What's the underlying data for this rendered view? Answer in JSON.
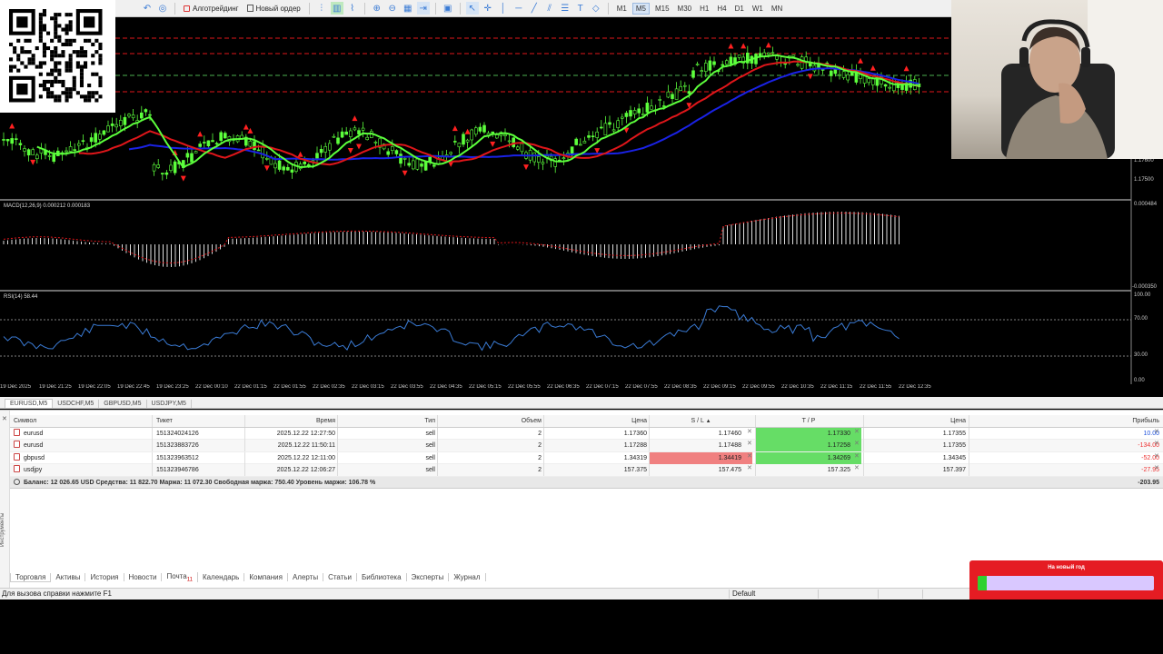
{
  "toolbar": {
    "algo_label": "Алготрейдинг",
    "new_order_label": "Новый ордер",
    "timeframes": [
      "M1",
      "M5",
      "M15",
      "M30",
      "H1",
      "H4",
      "D1",
      "W1",
      "MN"
    ],
    "active_timeframe": "M5"
  },
  "chart": {
    "price_labels": [
      "1.17600",
      "1.17500"
    ],
    "macd_label": "MACD(12,26,9) 0.000212 0.000183",
    "macd_top": "0.000484",
    "macd_bottom": "-0.000350",
    "rsi_label": "RSI(14) 58.44",
    "rsi_levels": [
      "100.00",
      "70.00",
      "30.00",
      "0.00"
    ],
    "time_labels": [
      "19 Dec 2025",
      "19 Dec 21:25",
      "19 Dec 22:05",
      "19 Dec 22:45",
      "19 Dec 23:25",
      "22 Dec 00:10",
      "22 Dec 01:15",
      "22 Dec 01:55",
      "22 Dec 02:35",
      "22 Dec 03:15",
      "22 Dec 03:55",
      "22 Dec 04:35",
      "22 Dec 05:15",
      "22 Dec 05:55",
      "22 Dec 06:35",
      "22 Dec 07:15",
      "22 Dec 07:55",
      "22 Dec 08:35",
      "22 Dec 09:15",
      "22 Dec 09:55",
      "22 Dec 10:35",
      "22 Dec 11:15",
      "22 Dec 11:55",
      "22 Dec 12:35"
    ]
  },
  "chart_tabs": [
    "EURUSD,M5",
    "USDCHF,M5",
    "GBPUSD,M5",
    "USDJPY,M5"
  ],
  "table": {
    "headers": {
      "symbol": "Символ",
      "ticket": "Тикет",
      "time": "Время",
      "type": "Тип",
      "volume": "Объем",
      "price": "Цена",
      "sl": "S / L",
      "tp": "T / P",
      "current": "Цена",
      "profit": "Прибыль"
    },
    "rows": [
      {
        "symbol": "eurusd",
        "ticket": "151324024126",
        "time": "2025.12.22 12:27:50",
        "type": "sell",
        "volume": "2",
        "price": "1.17360",
        "sl": "1.17460",
        "tp": "1.17330",
        "current": "1.17355",
        "profit": "10.00"
      },
      {
        "symbol": "eurusd",
        "ticket": "151323883726",
        "time": "2025.12.22 11:50:11",
        "type": "sell",
        "volume": "2",
        "price": "1.17288",
        "sl": "1.17488",
        "tp": "1.17258",
        "current": "1.17355",
        "profit": "-134.00"
      },
      {
        "symbol": "gbpusd",
        "ticket": "151323963512",
        "time": "2025.12.22 12:11:00",
        "type": "sell",
        "volume": "2",
        "price": "1.34319",
        "sl": "1.34419",
        "tp": "1.34269",
        "current": "1.34345",
        "profit": "-52.00"
      },
      {
        "symbol": "usdjpy",
        "ticket": "151323946786",
        "time": "2025.12.22 12:06:27",
        "type": "sell",
        "volume": "2",
        "price": "157.375",
        "sl": "157.475",
        "tp": "157.325",
        "current": "157.397",
        "profit": "-27.95"
      }
    ],
    "summary": "Баланс: 12 026.65 USD  Средства: 11 822.70  Маржа: 11 072.30  Свободная маржа: 750.40  Уровень маржи: 106.78 %",
    "summary_total": "-203.95"
  },
  "side_label": "Инструменты",
  "terminal_tabs": [
    "Торговля",
    "Активы",
    "История",
    "Новости",
    "Почта",
    "Календарь",
    "Компания",
    "Алерты",
    "Статьи",
    "Библиотека",
    "Эксперты",
    "Журнал"
  ],
  "mail_badge": "11",
  "status": {
    "help": "Для вызова справки нажмите F1",
    "profile": "Default"
  },
  "widget": {
    "title": "На новый год",
    "progress": 0.05
  },
  "colors": {
    "ma_fast": "#5cff3c",
    "ma_mid": "#e0161a",
    "ma_slow": "#1a22e6",
    "candles": "#5cff3c",
    "fractal": "#ff2020",
    "rsi": "#3a7bd5",
    "sl_highlight": "#f08080",
    "tp_highlight": "#66dd66",
    "loss": "#e33333",
    "gain": "#2255dd"
  }
}
